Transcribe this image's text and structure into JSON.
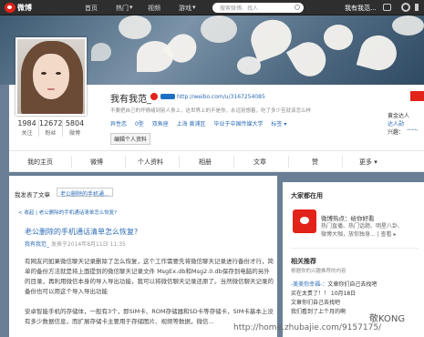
{
  "topbar": {
    "logo": "微博",
    "nav": [
      "首页",
      "热门",
      "视频",
      "游戏"
    ],
    "nav_arrow": "▾",
    "search_placeholder": "搜索微博、找人",
    "user": "我有我范..."
  },
  "profile": {
    "name": "我有我范_",
    "url": "http://weibo.com/u/3167254085",
    "bio": "不要把自己的坏情绪到别人身上，这世界上的不是你，永远别想着，吃了多少苦就该怎么样",
    "meta": [
      "异性恋",
      "0型",
      "双鱼座",
      "上海 黄浦区",
      "毕业于中国传媒大学",
      "标签 ▾"
    ],
    "tag_button": "编辑个人资料",
    "stats": [
      {
        "num": "1984",
        "label": "关注"
      },
      {
        "num": "12672",
        "label": "粉丝"
      },
      {
        "num": "5804",
        "label": "微博"
      }
    ],
    "right_info": [
      "黄金达人",
      "达人勋",
      "兴趣：",
      "宠物"
    ]
  },
  "tabs": [
    "我的主页",
    "微博",
    "个人资料",
    "相册",
    "文章",
    "赞",
    "更多 ▾"
  ],
  "feed": {
    "header": "我发表了文章",
    "tag": "老公删除的手机通...",
    "crumb": "< 收起  |  老公删除的手机通话清单怎么恢复?",
    "article_title": "老公删除的手机通话清单怎么恢复?",
    "author": "我有我范_",
    "date": "发表于2014年8月11日 11:35",
    "paragraph1": "有网友问如果微信聊天记录删除了怎么恢复，这个工作需要先将微信聊天记录进行备份才行，简单的备份方法就是将上面提到的微信聊天记录文件 MsgEx.db和Msg2.0.db保存到电脑的另外的目录，再利用微信本身的导入导出功能，我可以将微信聊天记录还原了。当然微信聊天记录的备份也可以用这个导入导出功能",
    "paragraph2": "安卓智能手机的存储体，一般有3个，即SIM卡、ROM存储器和SD卡等存储卡，SIM卡基本上没有多少数据信息，而扩展存储卡主要用于存储图片、视频等数据，微信..."
  },
  "sidebar": {
    "title": "大家都在用",
    "promo_name": "微博热点：给你好看",
    "promo_desc1": "热门直播、热门话题、明星八卦、",
    "promo_desc2": "微博大咖，放你独身...   | 查看 ▸",
    "related_title": "相关推荐",
    "related_sub": "根据你的兴趣推荐的内容",
    "rec": [
      {
        "who": "-美美你幸福-：",
        "text": "文章你们自己去找吧"
      },
      {
        "who": "",
        "text": "买在太贵了！！ 10月18日"
      },
      {
        "who": "",
        "text": "文章你们自己去找吧"
      },
      {
        "who": "",
        "text": "我们看到了上个月的啊"
      }
    ]
  },
  "watermark": {
    "kong": "敬KONG",
    "url": "http://home.zhubajie.com/9157175/"
  }
}
